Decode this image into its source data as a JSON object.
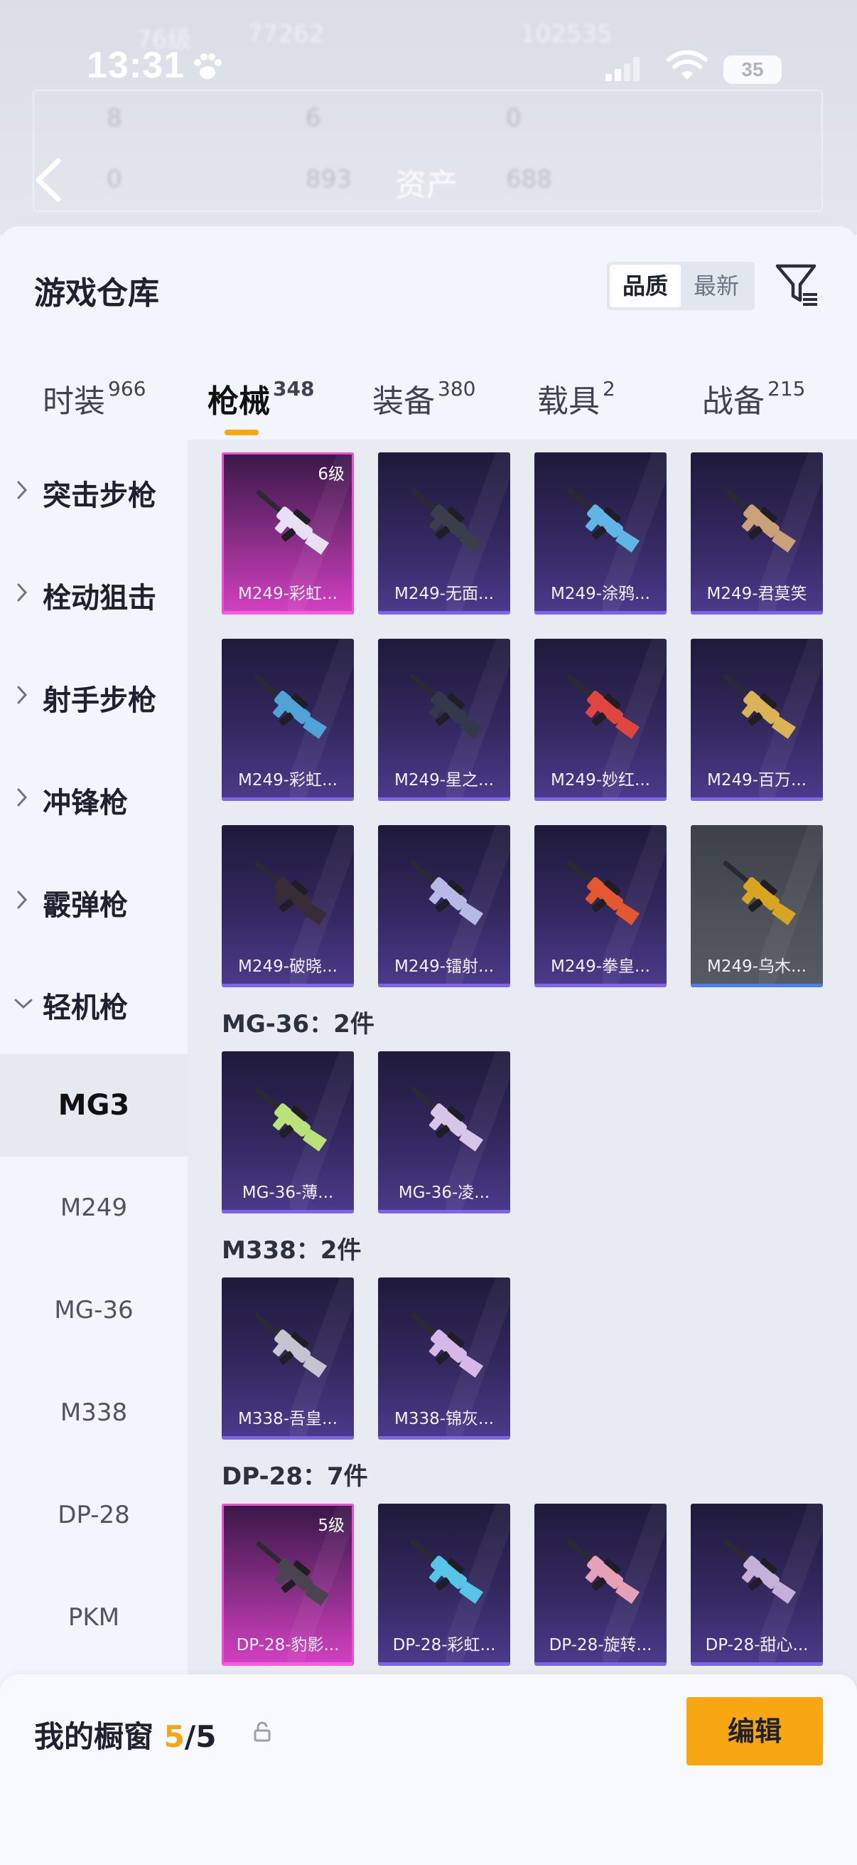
{
  "status_bar": {
    "time": "13:31",
    "battery": "35"
  },
  "background": {
    "title": "资产",
    "ghost_stats": [
      "76级",
      "77262",
      "102535",
      "8",
      "6",
      "0",
      "0",
      "893",
      "688"
    ]
  },
  "sheet": {
    "title": "游戏仓库",
    "sort": {
      "quality": "品质",
      "newest": "最新",
      "active": "quality"
    }
  },
  "tabs": [
    {
      "label": "时装",
      "count": "966"
    },
    {
      "label": "枪械",
      "count": "348",
      "active": true
    },
    {
      "label": "装备",
      "count": "380"
    },
    {
      "label": "载具",
      "count": "2"
    },
    {
      "label": "战备",
      "count": "215"
    }
  ],
  "sidebar": {
    "categories": [
      "突击步枪",
      "栓动狙击",
      "射手步枪",
      "冲锋枪",
      "霰弹枪",
      "轻机枪"
    ],
    "subcategories": [
      "MG3",
      "M249",
      "MG-36",
      "M338",
      "DP-28",
      "PKM"
    ],
    "active_sub": "MG3"
  },
  "grid": {
    "m249_items": [
      {
        "name": "M249-彩虹...",
        "level": "6级",
        "rarity": "pink"
      },
      {
        "name": "M249-无面...",
        "rarity": "purple"
      },
      {
        "name": "M249-涂鸦...",
        "rarity": "purple"
      },
      {
        "name": "M249-君莫笑",
        "rarity": "purple"
      },
      {
        "name": "M249-彩虹...",
        "rarity": "purple"
      },
      {
        "name": "M249-星之...",
        "rarity": "purple"
      },
      {
        "name": "M249-妙红...",
        "rarity": "purple"
      },
      {
        "name": "M249-百万...",
        "rarity": "purple"
      },
      {
        "name": "M249-破晓...",
        "rarity": "purple"
      },
      {
        "name": "M249-镭射...",
        "rarity": "purple"
      },
      {
        "name": "M249-拳皇...",
        "rarity": "purple"
      },
      {
        "name": "M249-乌木...",
        "rarity": "gray"
      }
    ],
    "sections": [
      {
        "heading": "MG-36：2件",
        "items": [
          {
            "name": "MG-36-薄...",
            "rarity": "purple"
          },
          {
            "name": "MG-36-凌...",
            "rarity": "purple"
          }
        ]
      },
      {
        "heading": "M338：2件",
        "items": [
          {
            "name": "M338-吾皇...",
            "rarity": "purple"
          },
          {
            "name": "M338-锦灰...",
            "rarity": "purple"
          }
        ]
      },
      {
        "heading": "DP-28：7件",
        "items": [
          {
            "name": "DP-28-豹影...",
            "level": "5级",
            "rarity": "pink"
          },
          {
            "name": "DP-28-彩虹...",
            "rarity": "purple"
          },
          {
            "name": "DP-28-旋转...",
            "rarity": "purple"
          },
          {
            "name": "DP-28-甜心...",
            "rarity": "purple"
          }
        ]
      }
    ]
  },
  "bottom_bar": {
    "label": "我的橱窗",
    "count": "5",
    "total": "/5",
    "edit_label": "编辑"
  },
  "colors": {
    "accent": "#f5a614",
    "purple_card": "#33285f",
    "pink_card": "#d23fc0"
  },
  "icons": [
    "paw-icon",
    "signal-icon",
    "wifi-icon",
    "back-icon",
    "filter-icon",
    "chevron-right-icon",
    "chevron-down-icon",
    "share-icon",
    "lock-icon",
    "rifle-icon"
  ]
}
